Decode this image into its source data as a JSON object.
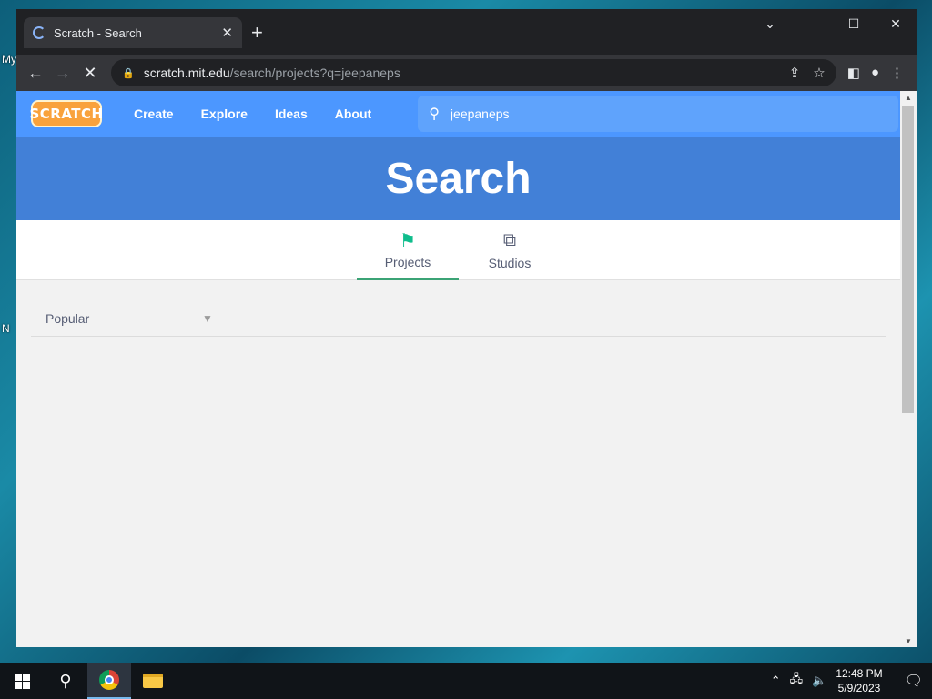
{
  "desktop": {
    "labels": [
      "My",
      "N"
    ]
  },
  "browser": {
    "tab_title": "Scratch - Search",
    "url_host": "scratch.mit.edu",
    "url_path": "/search/projects?q=jeepaneps"
  },
  "scratch": {
    "logo_text": "SCRATCH",
    "nav": [
      "Create",
      "Explore",
      "Ideas",
      "About"
    ],
    "search_value": "jeepaneps",
    "banner_title": "Search",
    "tabs": [
      {
        "label": "Projects",
        "icon": "flag-icon",
        "active": true
      },
      {
        "label": "Studios",
        "icon": "studios-icon",
        "active": false
      }
    ],
    "sort": {
      "selected": "Popular"
    }
  },
  "taskbar": {
    "time": "12:48 PM",
    "date": "5/9/2023"
  },
  "colors": {
    "nav_blue": "#4c97ff",
    "banner_blue": "#4280d7",
    "active_tab_green": "#3ba375"
  }
}
